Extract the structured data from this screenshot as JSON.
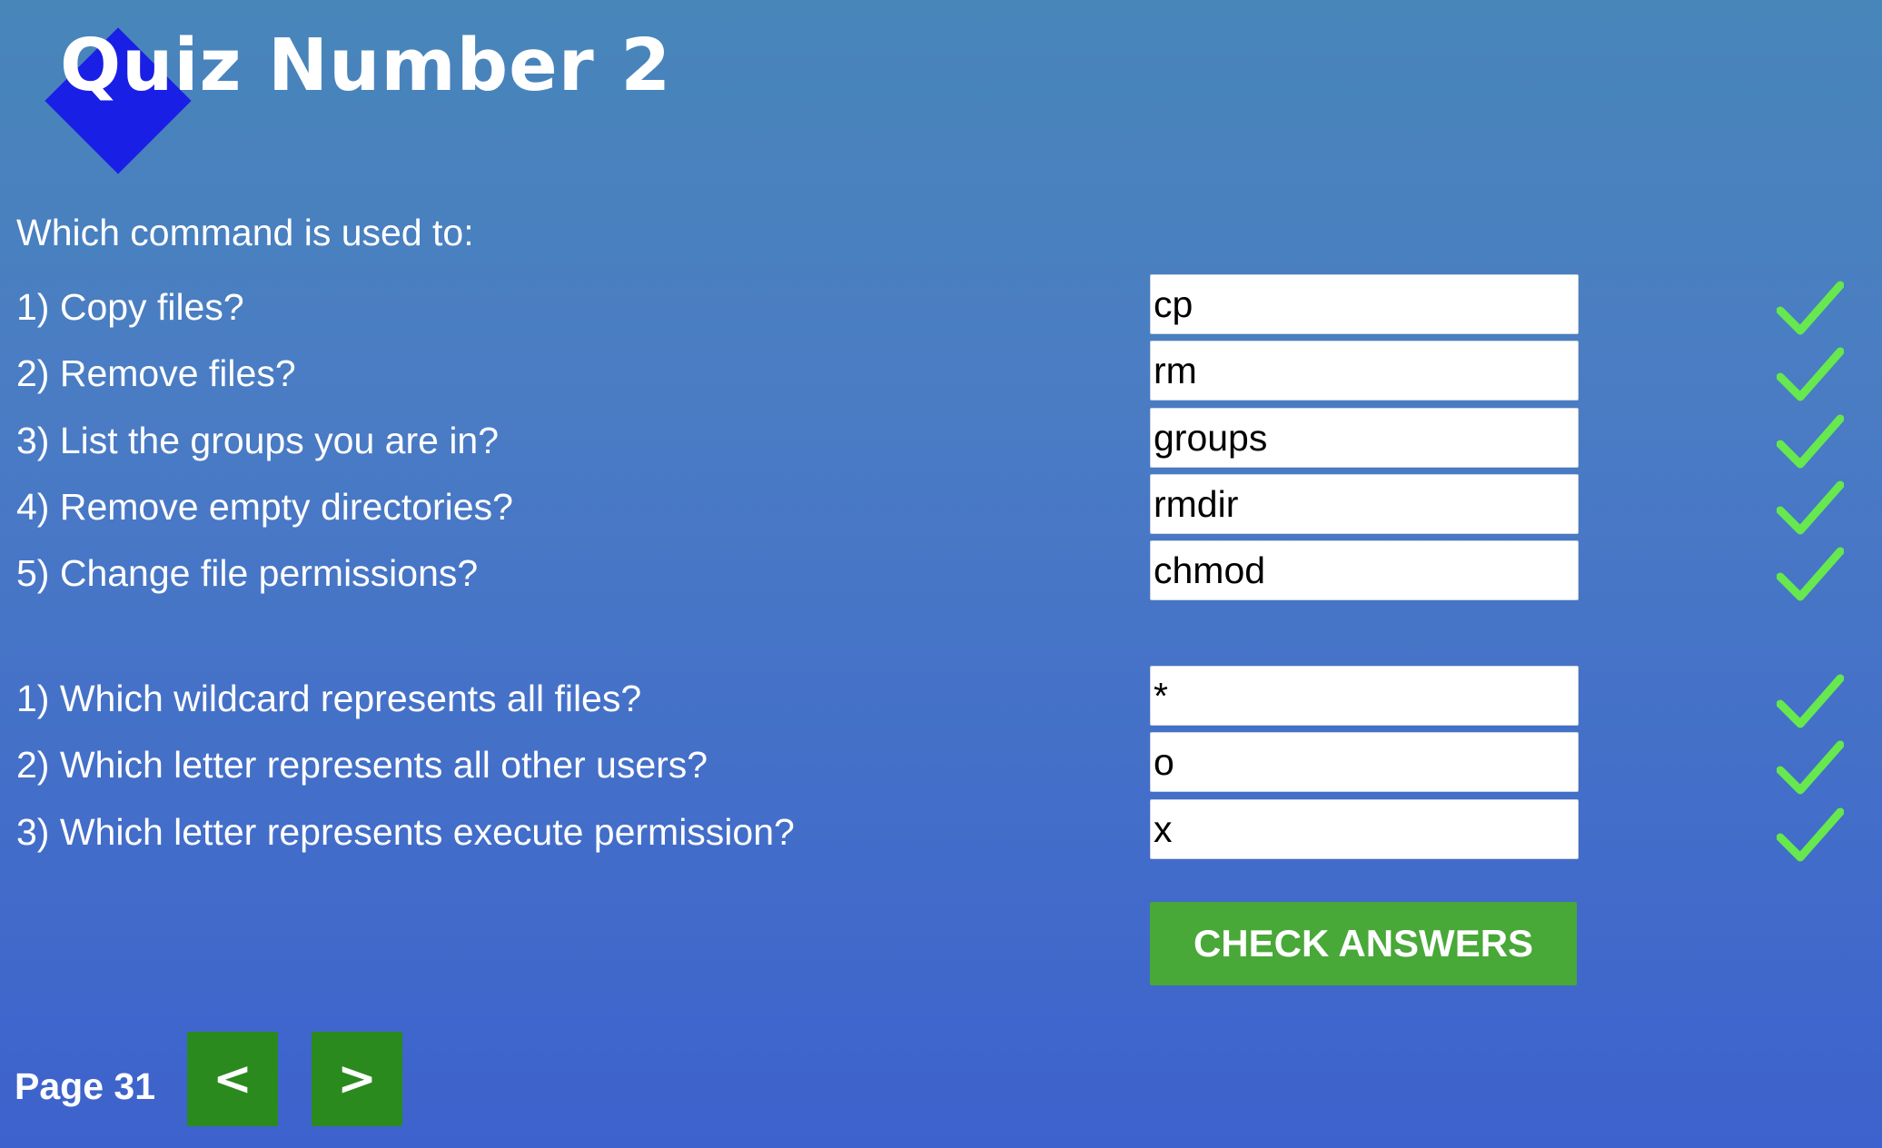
{
  "header": {
    "title": "Quiz Number 2"
  },
  "quiz": {
    "intro": "Which command is used to:",
    "section1": [
      {
        "question": "1) Copy files?",
        "answer": "cp",
        "correct": true
      },
      {
        "question": "2) Remove files?",
        "answer": "rm",
        "correct": true
      },
      {
        "question": "3) List the groups you are in?",
        "answer": "groups",
        "correct": true
      },
      {
        "question": "4) Remove empty directories?",
        "answer": "rmdir",
        "correct": true
      },
      {
        "question": "5) Change file permissions?",
        "answer": "chmod",
        "correct": true
      }
    ],
    "section2": [
      {
        "question": "1) Which wildcard represents all files?",
        "answer": "*",
        "correct": true
      },
      {
        "question": "2) Which letter represents all other users?",
        "answer": "o",
        "correct": true
      },
      {
        "question": "3) Which letter represents execute permission?",
        "answer": "x",
        "correct": true
      }
    ],
    "check_button_label": "CHECK ANSWERS"
  },
  "footer": {
    "page_label": "Page 31",
    "prev_label": "<",
    "next_label": ">"
  },
  "colors": {
    "logo": "#1a1fe6",
    "check_mark": "#66e84e",
    "check_button": "#48a838",
    "nav_button": "#2b8a1e"
  },
  "icons": {
    "correct": "checkmark-icon"
  }
}
